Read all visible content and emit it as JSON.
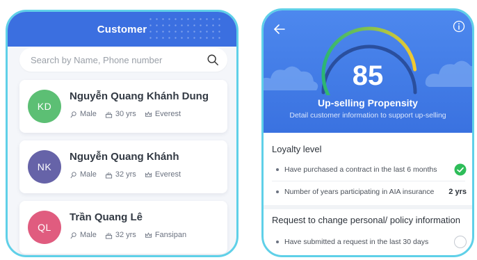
{
  "customer_screen": {
    "header_title": "Customer",
    "search": {
      "placeholder": "Search by Name, Phone number",
      "icon": "search-icon"
    },
    "customers": [
      {
        "initials": "KD",
        "name": "Nguyễn Quang Khánh Dung",
        "gender": "Male",
        "age": "30 yrs",
        "tier": "Everest",
        "avatar_color": "#5cbf74"
      },
      {
        "initials": "NK",
        "name": "Nguyễn Quang Khánh",
        "gender": "Male",
        "age": "32 yrs",
        "tier": "Everest",
        "avatar_color": "#6663a8"
      },
      {
        "initials": "QL",
        "name": "Trần Quang Lê",
        "gender": "Male",
        "age": "32 yrs",
        "tier": "Fansipan",
        "avatar_color": "#e05c7f"
      }
    ]
  },
  "propensity_screen": {
    "score": "85",
    "score_value": 85,
    "title": "Up-selling Propensity",
    "subtitle": "Detail customer information to support up-selling",
    "loyalty": {
      "heading": "Loyalty level",
      "items": [
        {
          "text": "Have purchased a contract in the last 6 months",
          "status": "checked"
        },
        {
          "text": "Number of years participating in AIA insurance",
          "value": "2 yrs"
        }
      ]
    },
    "request": {
      "heading": "Request to change personal/ policy information",
      "items": [
        {
          "text": "Have submitted a request in the last 30 days",
          "status": "unchecked"
        }
      ]
    }
  },
  "colors": {
    "primary": "#3b6fe0",
    "frame": "#5fd0e8",
    "success": "#2ebd59",
    "gauge_yellow": "#f4c931"
  }
}
